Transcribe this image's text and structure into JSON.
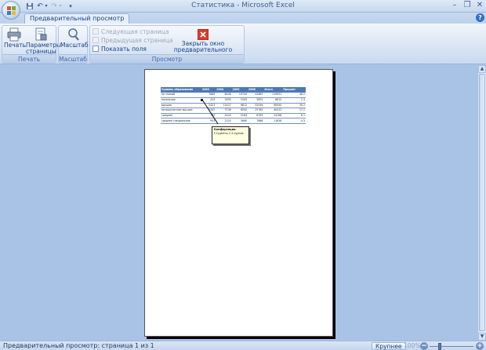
{
  "window": {
    "title": "Статистика - Microsoft Excel",
    "quick_access": {
      "save_icon": "save-icon",
      "undo_icon": "undo-icon",
      "redo_icon": "redo-icon",
      "customize_icon": "chevron-down-icon"
    }
  },
  "ribbon": {
    "tab_label": "Предварительный просмотр",
    "groups": {
      "print": {
        "label": "Печать",
        "print_button": "Печать",
        "page_setup_button_line1": "Параметры",
        "page_setup_button_line2": "страницы"
      },
      "zoom": {
        "label": "Масштаб",
        "zoom_button": "Масштаб"
      },
      "preview": {
        "label": "Просмотр",
        "next_page": "Следующая страница",
        "prev_page": "Предыдущая страница",
        "show_margins": "Показать поля",
        "close_line1": "Закрыть окно",
        "close_line2": "предварительного просмотра"
      }
    }
  },
  "sheet": {
    "headers": [
      "Уровень образования",
      "2003",
      "2004",
      "2005",
      "2006",
      "Итого",
      "Процент"
    ],
    "rows": [
      [
        "не знаний",
        "7669",
        "8446",
        "10744",
        "42883",
        "129931",
        "46.2"
      ],
      [
        "начальное",
        "413",
        "1630",
        "1043",
        "2831",
        "6612",
        "2.3"
      ],
      [
        "высшее",
        "5423",
        "12427",
        "9812",
        "32094",
        "90050",
        "30.2"
      ],
      [
        "незаконченное высшее",
        "2352",
        "7236",
        "6592",
        "25783",
        "40412",
        "17.1"
      ],
      [
        "среднее",
        "763",
        "2424",
        "2184",
        "8763",
        "14198",
        "6.1"
      ],
      [
        "среднее специальное",
        "953",
        "2220",
        "3660",
        "7866",
        "11638",
        "4.3"
      ]
    ],
    "comment": {
      "author": "Конференция:",
      "text": "Студенты 2-3 курсов"
    }
  },
  "statusbar": {
    "text": "Предварительный просмотр: страница 1 из 1",
    "zoom_in_label": "Крупнее",
    "zoom_percent": "100%"
  },
  "colors": {
    "accent": "#15428b",
    "workspace": "#a9c3e6",
    "table_header": "#4c79b6"
  }
}
